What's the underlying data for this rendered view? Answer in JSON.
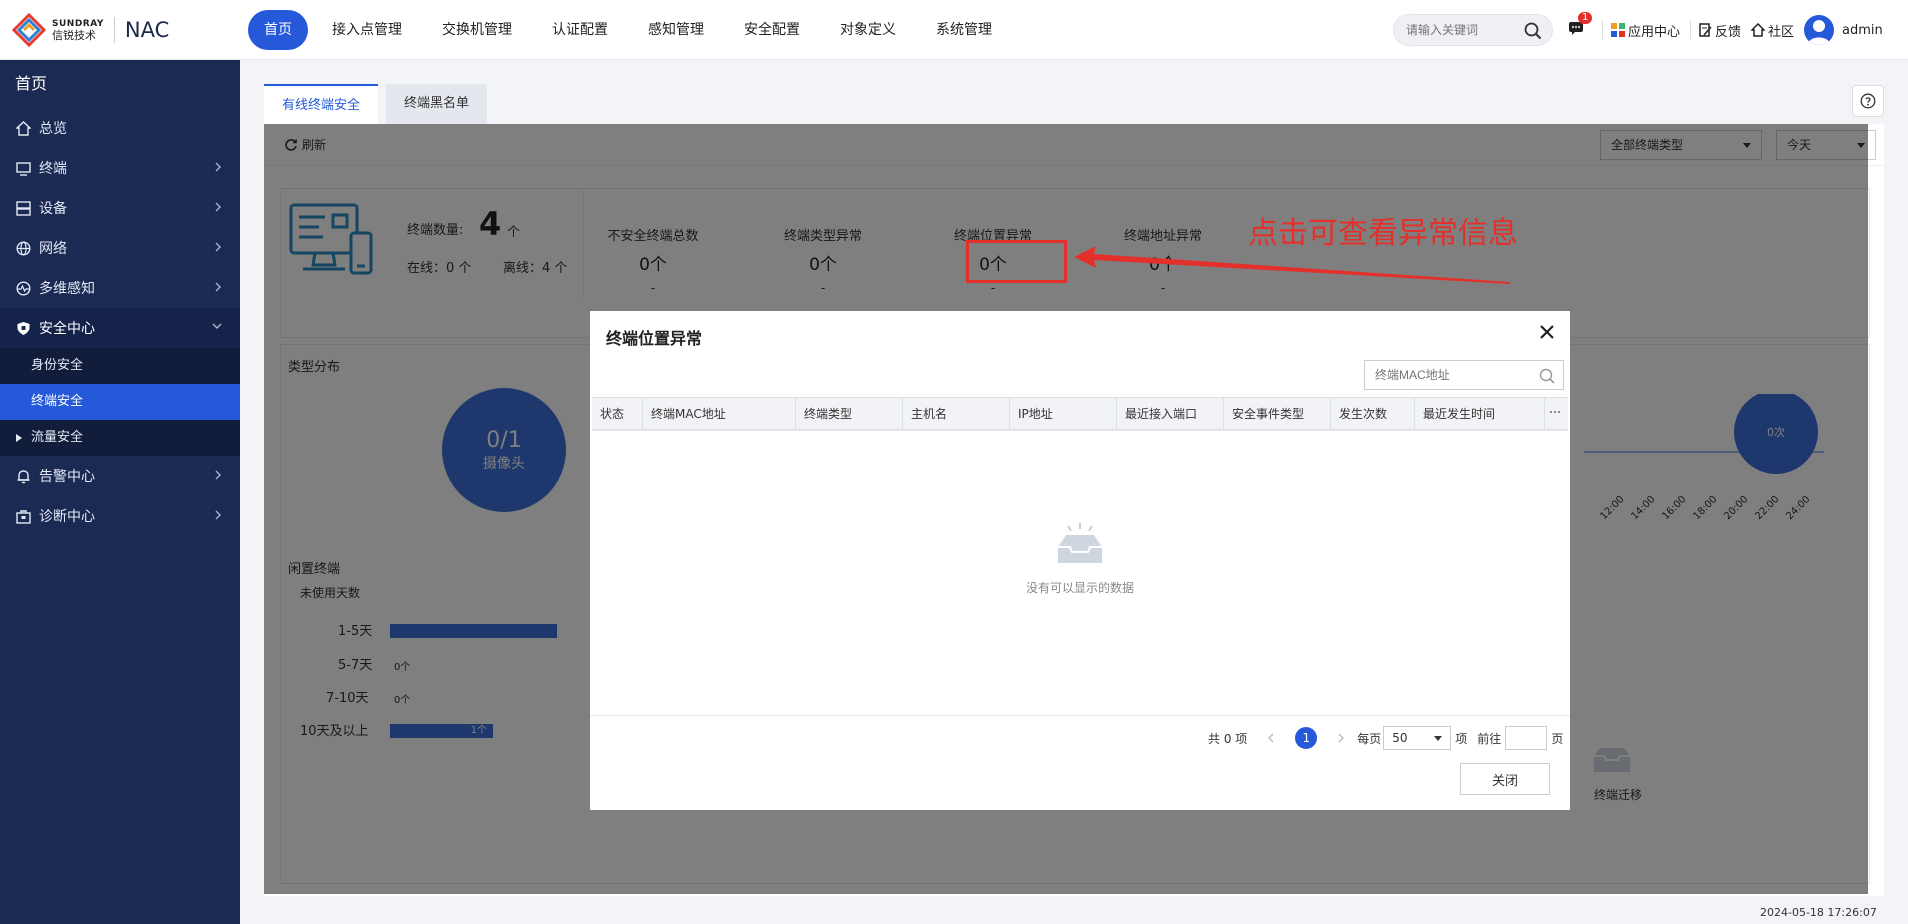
{
  "brand": {
    "en": "SUNDRAY",
    "cn": "信锐技术",
    "product": "NAC"
  },
  "nav": [
    "首页",
    "接入点管理",
    "交换机管理",
    "认证配置",
    "感知管理",
    "安全配置",
    "对象定义",
    "系统管理"
  ],
  "search": {
    "placeholder": "请输入关键词"
  },
  "top_right": {
    "msg_badge": "1",
    "app_center": "应用中心",
    "feedback": "反馈",
    "community": "社区",
    "user": "admin"
  },
  "sidebar": {
    "home": "首页",
    "items": [
      "总览",
      "终端",
      "设备",
      "网络",
      "多维感知",
      "安全中心"
    ],
    "sub": [
      "身份安全",
      "终端安全",
      "流量安全"
    ],
    "items2": [
      "告警中心",
      "诊断中心"
    ]
  },
  "tabs": [
    "有线终端安全",
    "终端黑名单"
  ],
  "toolbar": {
    "refresh": "刷新",
    "type_filter": "全部终端类型",
    "date_filter": "今天"
  },
  "stats": {
    "count_label": "终端数量:",
    "count_value": "4",
    "count_unit": "个",
    "online": "在线：0 个",
    "offline": "离线：4 个",
    "items": [
      {
        "label": "不安全终端总数",
        "value": "0个",
        "delta": "-"
      },
      {
        "label": "终端类型异常",
        "value": "0个",
        "delta": "-"
      },
      {
        "label": "终端位置异常",
        "value": "0个",
        "delta": "-"
      },
      {
        "label": "终端地址异常",
        "value": "0个",
        "delta": "-"
      }
    ]
  },
  "annotation": "点击可查看异常信息",
  "type_dist": {
    "title": "类型分布",
    "ratio": "0/1",
    "label": "摄像头"
  },
  "idle": {
    "title": "闲置终端",
    "subtitle": "未使用天数",
    "rows": [
      {
        "label": "1-5天",
        "value": "",
        "fraction": 0.62
      },
      {
        "label": "5-7天",
        "value": "0个",
        "fraction": 0
      },
      {
        "label": "7-10天",
        "value": "0个",
        "fraction": 0
      },
      {
        "label": "10天及以上",
        "value": "1个",
        "fraction": 0.38
      }
    ]
  },
  "bg_chart": {
    "bubble": "0次",
    "ticks": [
      "12:00",
      "14:00",
      "16:00",
      "18:00",
      "20:00",
      "22:00",
      "24:00"
    ],
    "migrate": "终端迁移"
  },
  "modal": {
    "title": "终端位置异常",
    "search_placeholder": "终端MAC地址",
    "columns": [
      "状态",
      "终端MAC地址",
      "终端类型",
      "主机名",
      "IP地址",
      "最近接入端口",
      "安全事件类型",
      "发生次数",
      "最近发生时间"
    ],
    "empty": "没有可以显示的数据",
    "pager": {
      "total": "共 0 项",
      "page": "1",
      "per_page_label": "每页",
      "per_page": "50",
      "unit": "项",
      "goto": "前往",
      "page_unit": "页"
    },
    "close": "关闭"
  },
  "timestamp": "2024-05-18 17:26:07"
}
